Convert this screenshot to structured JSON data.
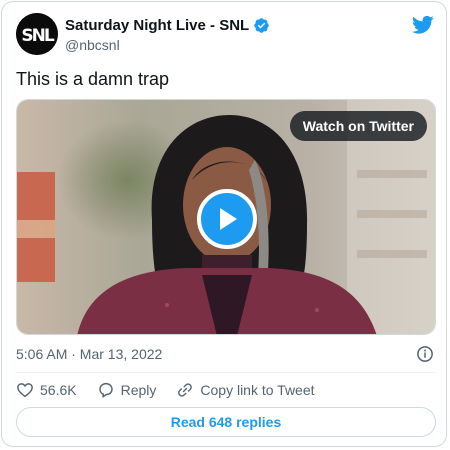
{
  "author": {
    "display_name": "Saturday Night Live - SNL",
    "handle": "@nbcsnl",
    "avatar_text": "SNL",
    "verified": true
  },
  "tweet": {
    "text": "This is a damn trap",
    "timestamp": "5:06 AM · Mar 13, 2022"
  },
  "media": {
    "watch_label": "Watch on Twitter"
  },
  "actions": {
    "likes": "56.6K",
    "reply_label": "Reply",
    "copy_link_label": "Copy link to Tweet"
  },
  "footer": {
    "read_replies_label": "Read 648 replies"
  },
  "colors": {
    "accent": "#1d9bf0",
    "text": "#0f1419",
    "muted": "#536471",
    "border": "#cfd9de"
  },
  "icons": [
    "twitter-bird-icon",
    "verified-badge-icon",
    "play-icon",
    "info-icon",
    "heart-icon",
    "reply-icon",
    "link-icon"
  ]
}
